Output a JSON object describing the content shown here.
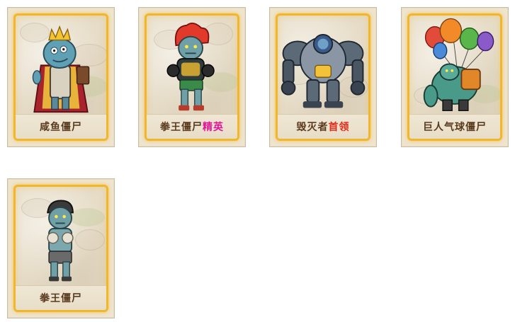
{
  "cards": [
    {
      "name": "咸鱼僵尸",
      "tag": ""
    },
    {
      "name": "拳王僵尸",
      "tag": "精英",
      "tag_color": "#e4139a"
    },
    {
      "name": "毁灭者",
      "tag": "首领",
      "tag_color": "#e62a18"
    },
    {
      "name": "巨人气球僵尸",
      "tag": ""
    },
    {
      "name": "拳王僵尸",
      "tag": ""
    }
  ]
}
